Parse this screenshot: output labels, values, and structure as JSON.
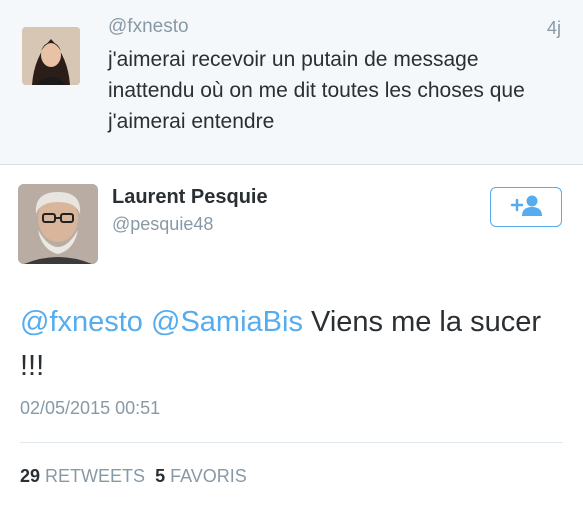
{
  "context_tweet": {
    "handle": "@fxnesto",
    "time": "4j",
    "text": "j'aimerai recevoir un putain de message inattendu où on me dit toutes les choses que j'aimerai entendre"
  },
  "tweet": {
    "author_name": "Laurent Pesquie",
    "author_handle": "@pesquie48",
    "mention_1": "@fxnesto",
    "mention_2": "@SamiaBis",
    "body": "Viens me la sucer  !!!",
    "timestamp": "02/05/2015 00:51",
    "retweets_count": "29",
    "retweets_label": "RETWEETS",
    "favorites_count": "5",
    "favorites_label": "FAVORIS"
  },
  "icons": {
    "follow": "add-user-icon"
  },
  "colors": {
    "link": "#55acee",
    "muted": "#8899a6",
    "text": "#292f33"
  }
}
